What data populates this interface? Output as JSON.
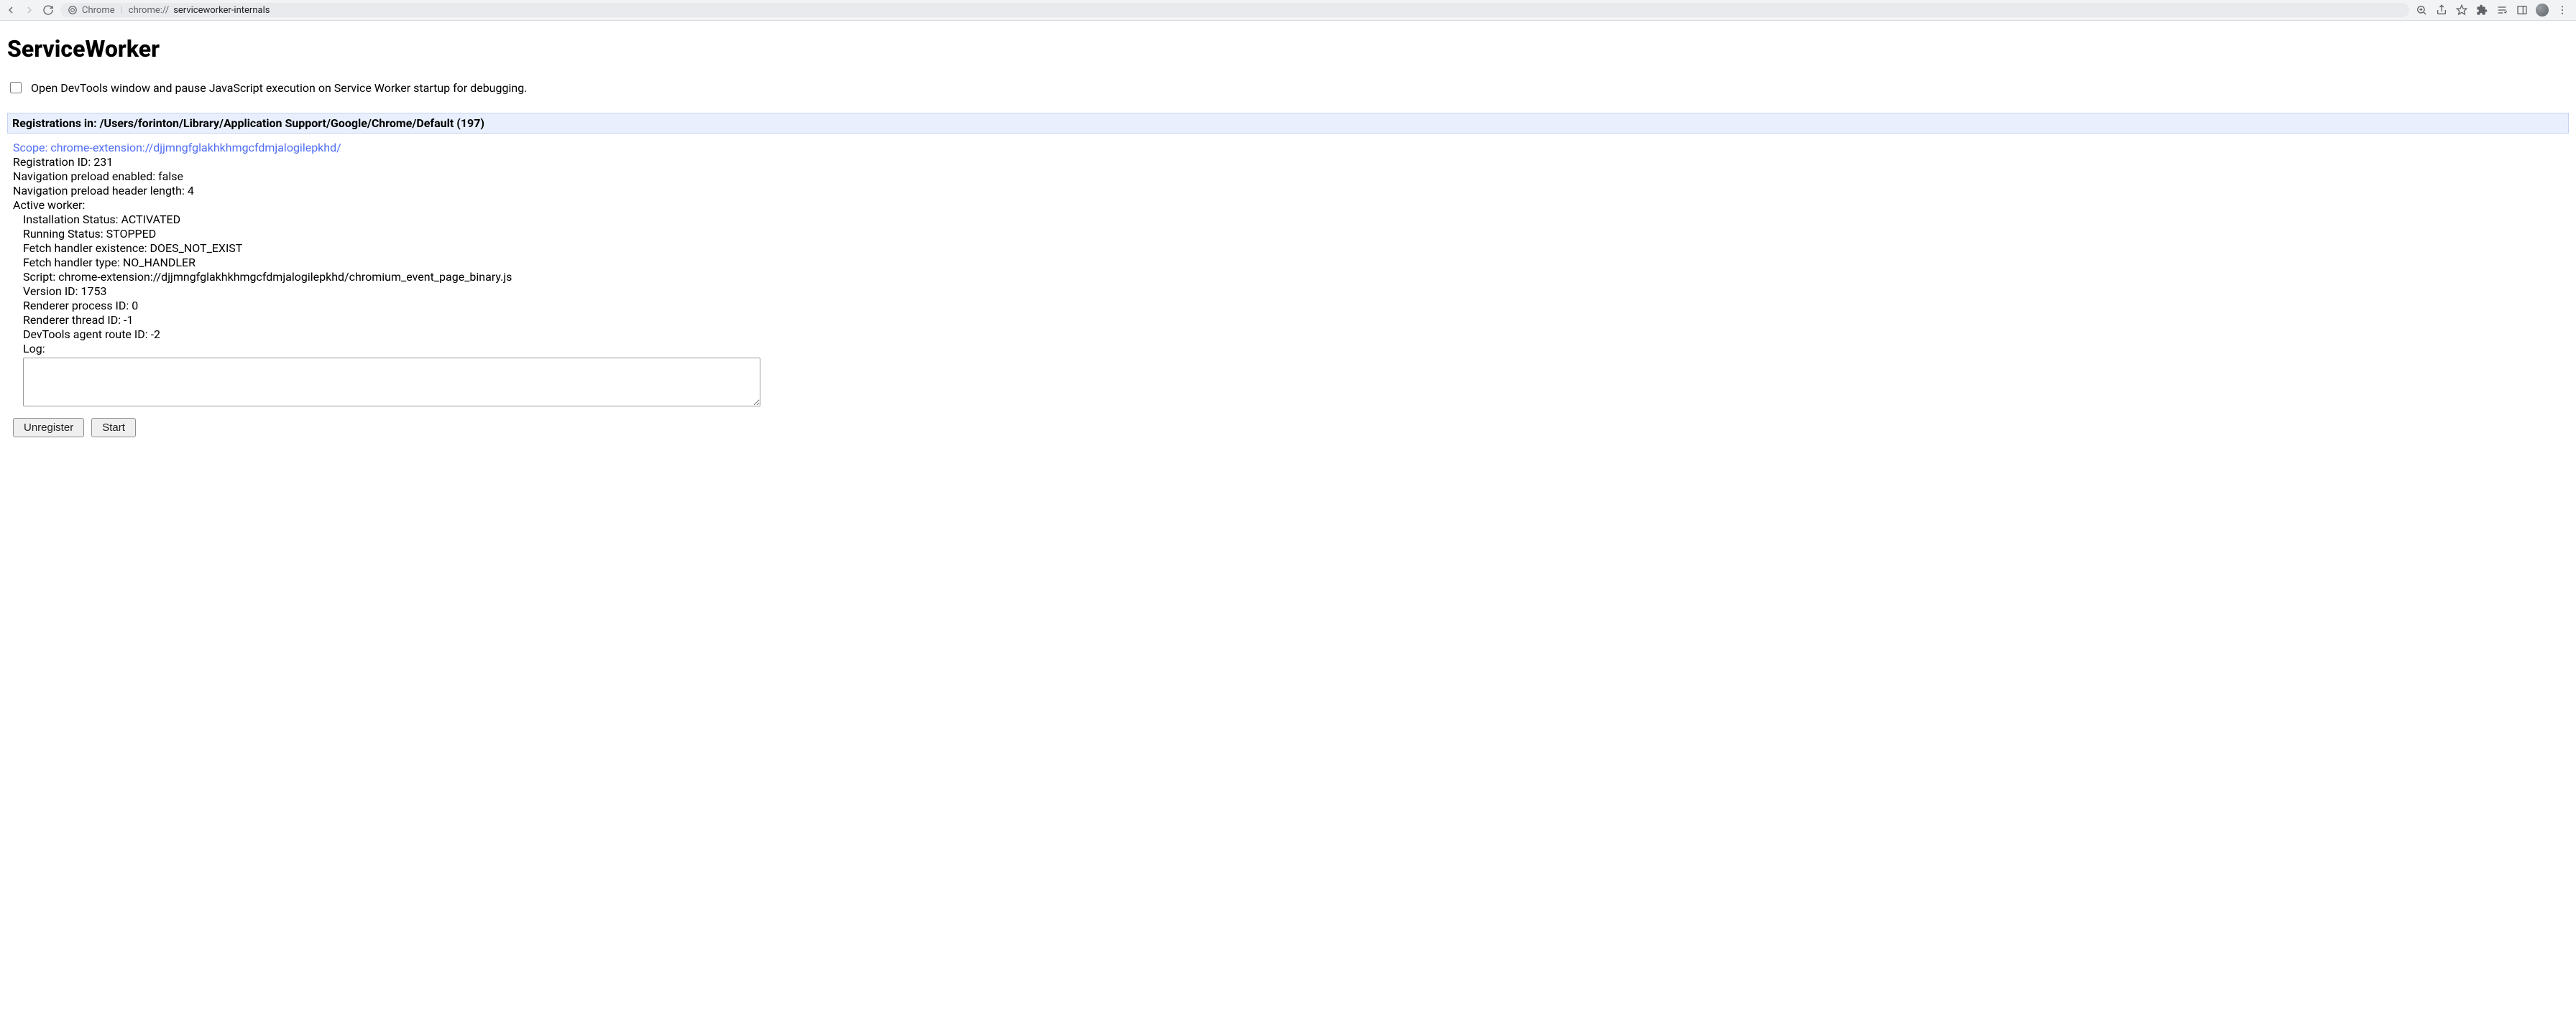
{
  "browser": {
    "origin_label": "Chrome",
    "url_scheme": "chrome://",
    "url_path": "serviceworker-internals"
  },
  "page": {
    "title": "ServiceWorker",
    "debug_checkbox_label": "Open DevTools window and pause JavaScript execution on Service Worker startup for debugging.",
    "registrations_header": "Registrations in: /Users/forinton/Library/Application Support/Google/Chrome/Default (197)"
  },
  "entry": {
    "scope_label": "Scope: ",
    "scope_url": "chrome-extension://djjmngfglakhkhmgcfdmjalogilepkhd/",
    "fields": {
      "registration_id": "Registration ID: 231",
      "nav_preload_enabled": "Navigation preload enabled: false",
      "nav_preload_header_len": "Navigation preload header length: 4",
      "active_worker": "Active worker:"
    },
    "worker": {
      "install_status": "Installation Status: ACTIVATED",
      "running_status": "Running Status: STOPPED",
      "fetch_handler_existence": "Fetch handler existence: DOES_NOT_EXIST",
      "fetch_handler_type": "Fetch handler type: NO_HANDLER",
      "script": "Script: chrome-extension://djjmngfglakhkhmgcfdmjalogilepkhd/chromium_event_page_binary.js",
      "version_id": "Version ID: 1753",
      "renderer_pid": "Renderer process ID: 0",
      "renderer_tid": "Renderer thread ID: -1",
      "devtools_route": "DevTools agent route ID: -2",
      "log_label": "Log:",
      "log_value": ""
    },
    "buttons": {
      "unregister": "Unregister",
      "start": "Start"
    }
  }
}
